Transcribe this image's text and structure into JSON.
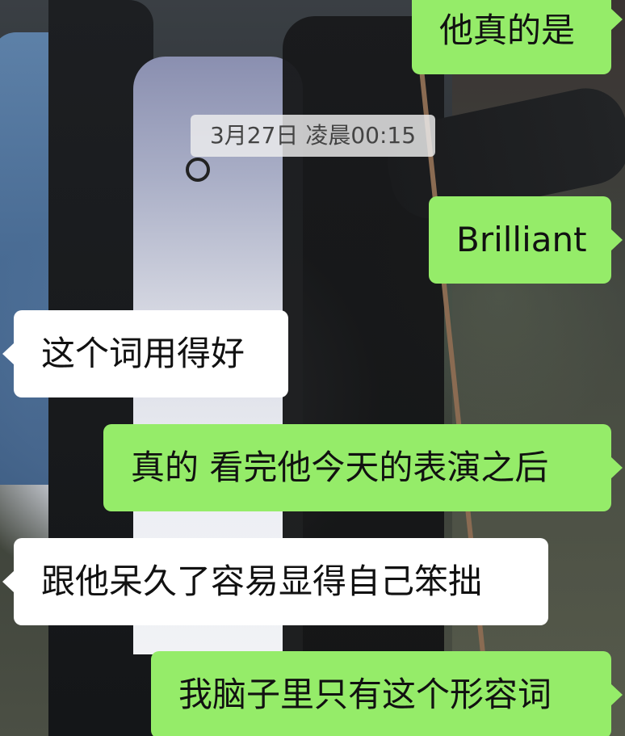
{
  "timestamp": "3月27日 凌晨00:15",
  "messages": [
    {
      "side": "sent",
      "text": "他真的是"
    },
    {
      "side": "sent",
      "text": "Brilliant"
    },
    {
      "side": "received",
      "text": "这个词用得好"
    },
    {
      "side": "sent",
      "text": "真的 看完他今天的表演之后"
    },
    {
      "side": "received",
      "text": "跟他呆久了容易显得自己笨拙"
    },
    {
      "side": "sent",
      "text": "我脑子里只有这个形容词"
    }
  ],
  "colors": {
    "sent_bubble": "#95ec69",
    "received_bubble": "#ffffff",
    "timestamp_bg": "#eeeeee"
  }
}
